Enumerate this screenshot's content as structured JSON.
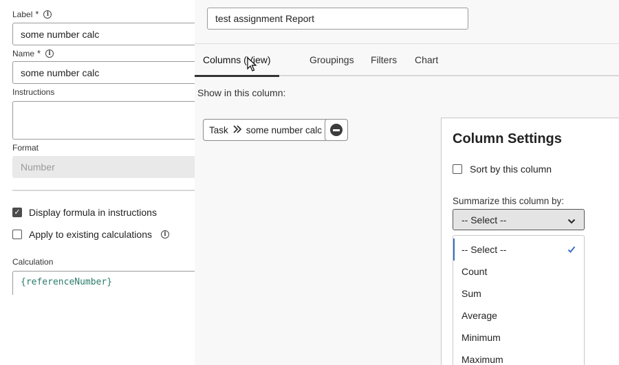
{
  "form": {
    "label_field": {
      "label": "Label",
      "required_mark": "*",
      "value": "some number calc"
    },
    "name_field": {
      "label": "Name",
      "required_mark": "*",
      "value": "some number calc"
    },
    "instructions_field": {
      "label": "Instructions",
      "value": ""
    },
    "format_field": {
      "label": "Format",
      "placeholder": "Number"
    },
    "display_formula": {
      "label": "Display formula in instructions",
      "checked": true
    },
    "apply_existing": {
      "label": "Apply to existing calculations",
      "checked": false
    },
    "calculation": {
      "label": "Calculation",
      "code": "{referenceNumber}"
    }
  },
  "report": {
    "name": "test assignment Report",
    "tabs": [
      "Columns (View)",
      "Groupings",
      "Filters",
      "Chart"
    ],
    "active_tab": 0,
    "show_label": "Show in this column:",
    "column_chip": {
      "object": "Task",
      "field": "some number calc"
    }
  },
  "column_settings": {
    "title": "Column Settings",
    "sort_label": "Sort by this column",
    "sort_checked": false,
    "summarize_label": "Summarize this column by:",
    "selected_value": "-- Select --",
    "options": [
      "-- Select --",
      "Count",
      "Sum",
      "Average",
      "Minimum",
      "Maximum"
    ],
    "selected_index": 0
  },
  "colors": {
    "accent": "#3a6fc4",
    "code": "#2a7a6a"
  },
  "icons": [
    "info-icon",
    "checkbox-icon",
    "remove-icon",
    "chevron-down-icon",
    "checkmark-icon",
    "double-chevron-icon",
    "mouse-cursor-icon"
  ]
}
